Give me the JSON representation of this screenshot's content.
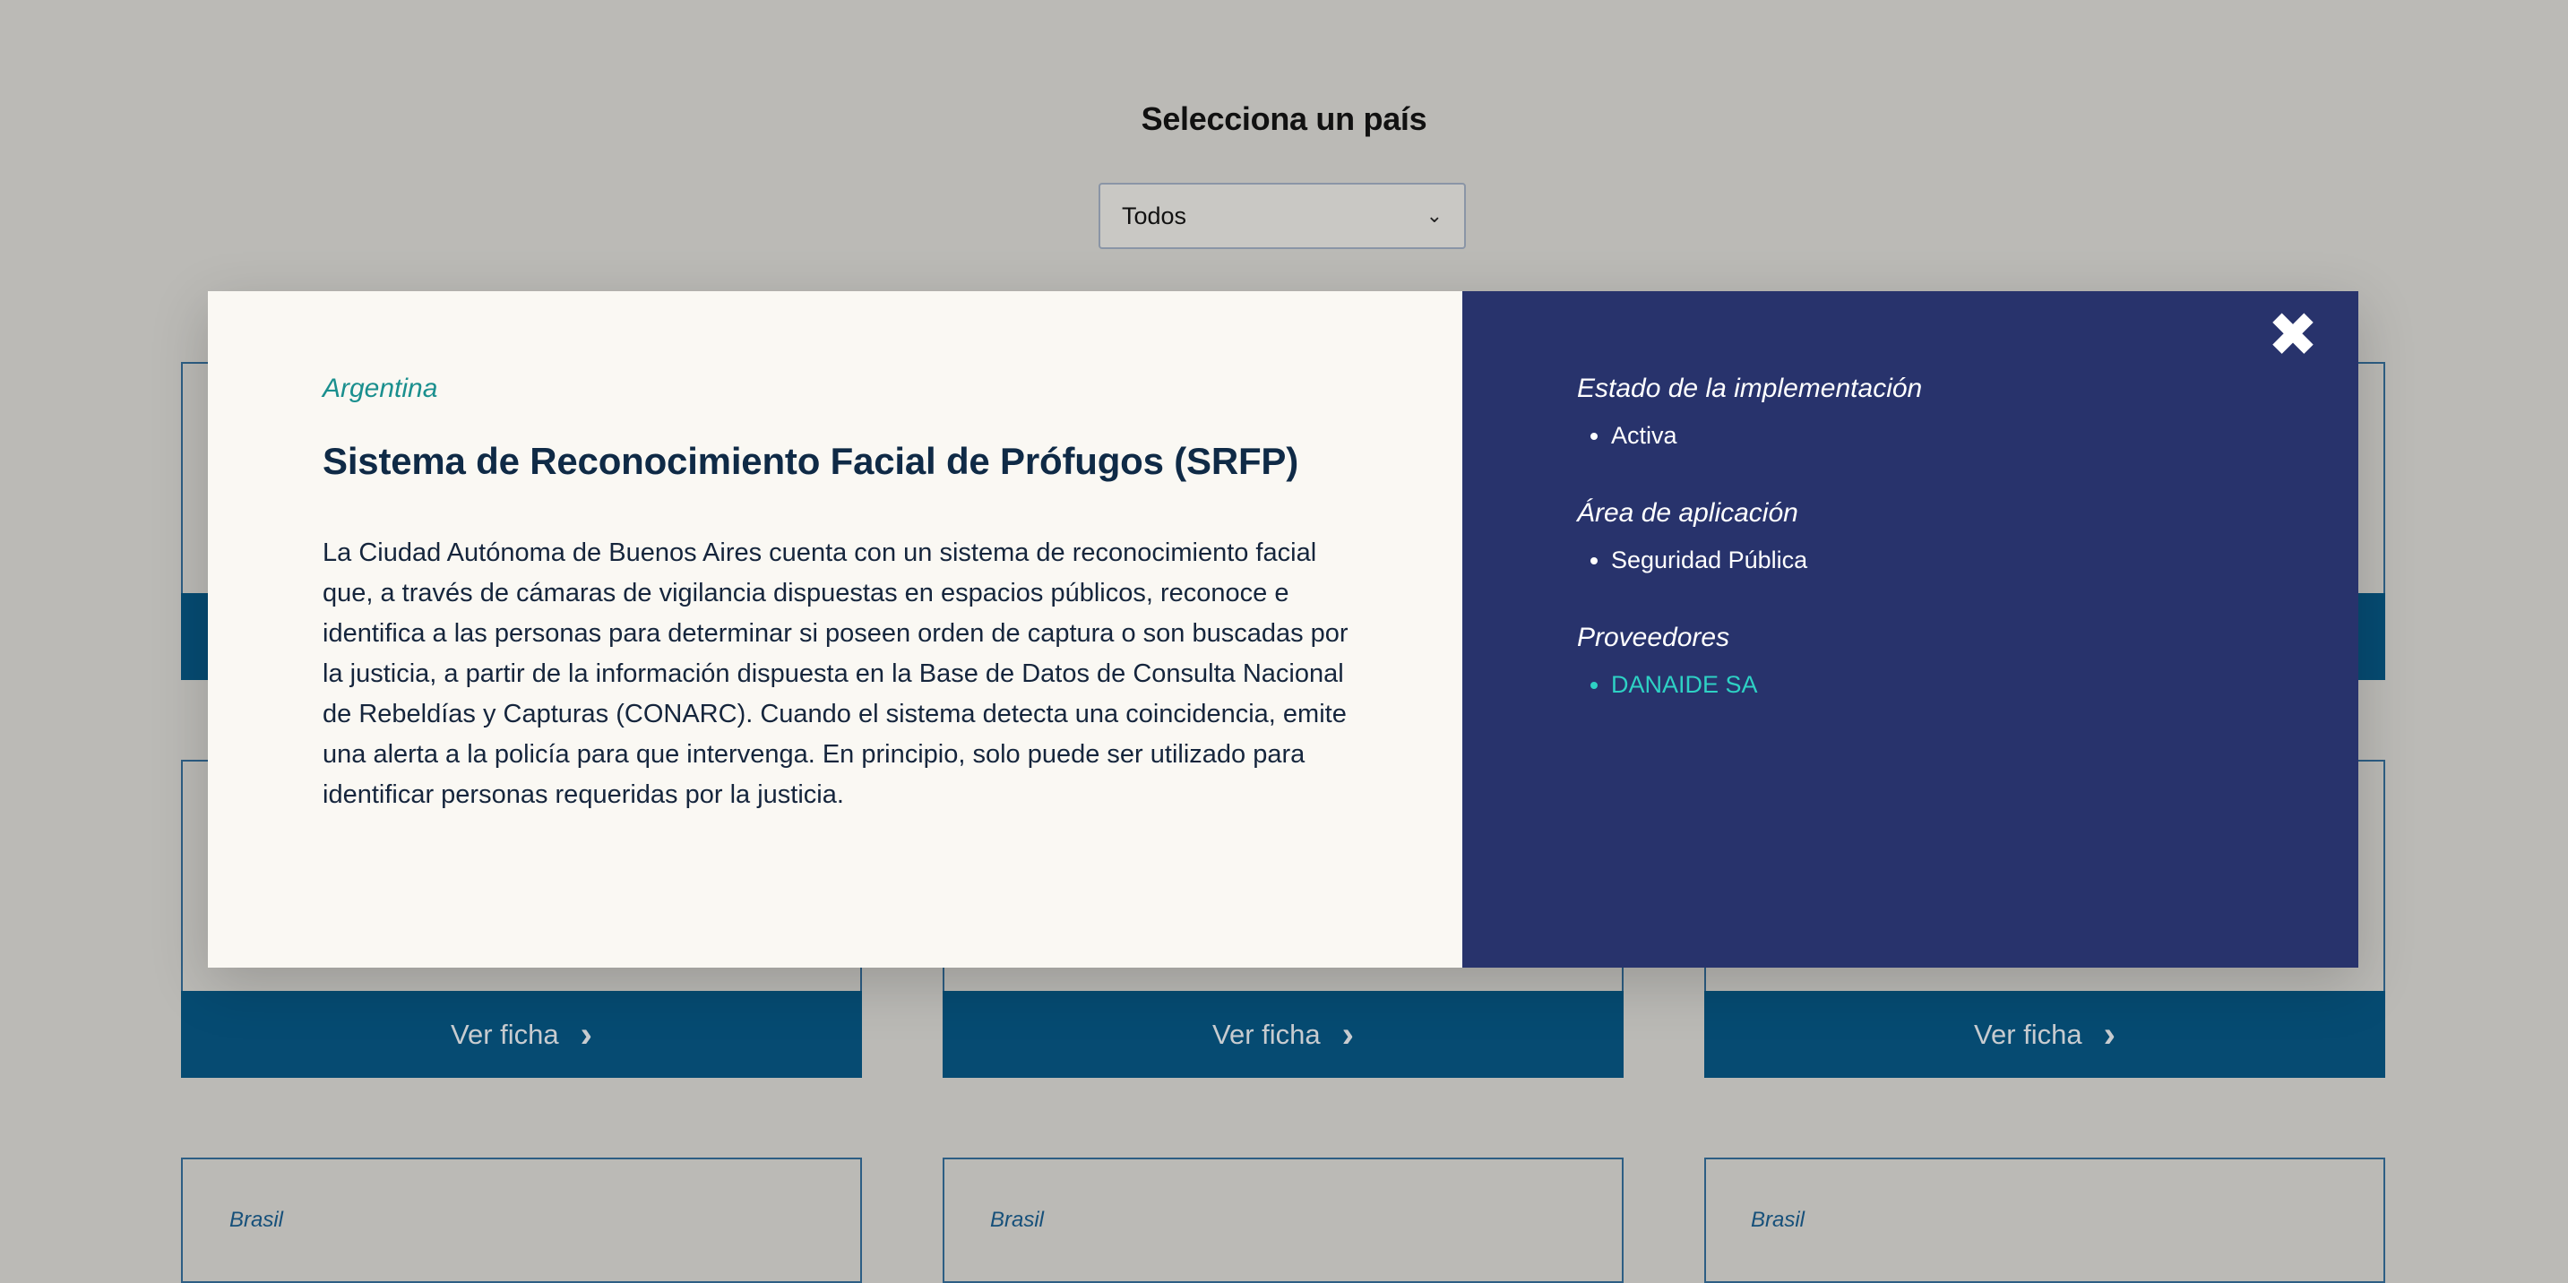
{
  "filter": {
    "heading": "Selecciona un país",
    "selected": "Todos"
  },
  "cards": {
    "button_label": "Ver ficha",
    "bottom_row_country": "Brasil"
  },
  "modal": {
    "country": "Argentina",
    "title": "Sistema de Reconocimiento Facial de Prófugos (SRFP)",
    "description": "La Ciudad Autónoma de Buenos Aires cuenta con un sistema de reconocimiento facial que, a través de cámaras de vigilancia dispuestas en espacios públicos, reconoce e identifica a las personas para determinar si poseen orden de captura o son buscadas por la justicia, a partir de la información dispuesta en la Base de Datos de Consulta Nacional de Rebeldías y Capturas (CONARC). Cuando el sistema detecta una coincidencia, emite una alerta a la policía para que intervenga. En principio, solo puede ser utilizado para identificar personas requeridas por la justicia.",
    "close_icon": "close-icon",
    "status": {
      "heading": "Estado de la implementación",
      "value": "Activa"
    },
    "area": {
      "heading": "Área de aplicación",
      "value": "Seguridad Pública"
    },
    "providers": {
      "heading": "Proveedores",
      "items": [
        "DANAIDE SA"
      ]
    }
  },
  "colors": {
    "background": "#bbbab6",
    "card_button": "#064b72",
    "modal_left": "#faf8f3",
    "modal_right": "#28336c",
    "accent_teal": "#1a8f8e",
    "provider_link": "#2ed1c4"
  }
}
